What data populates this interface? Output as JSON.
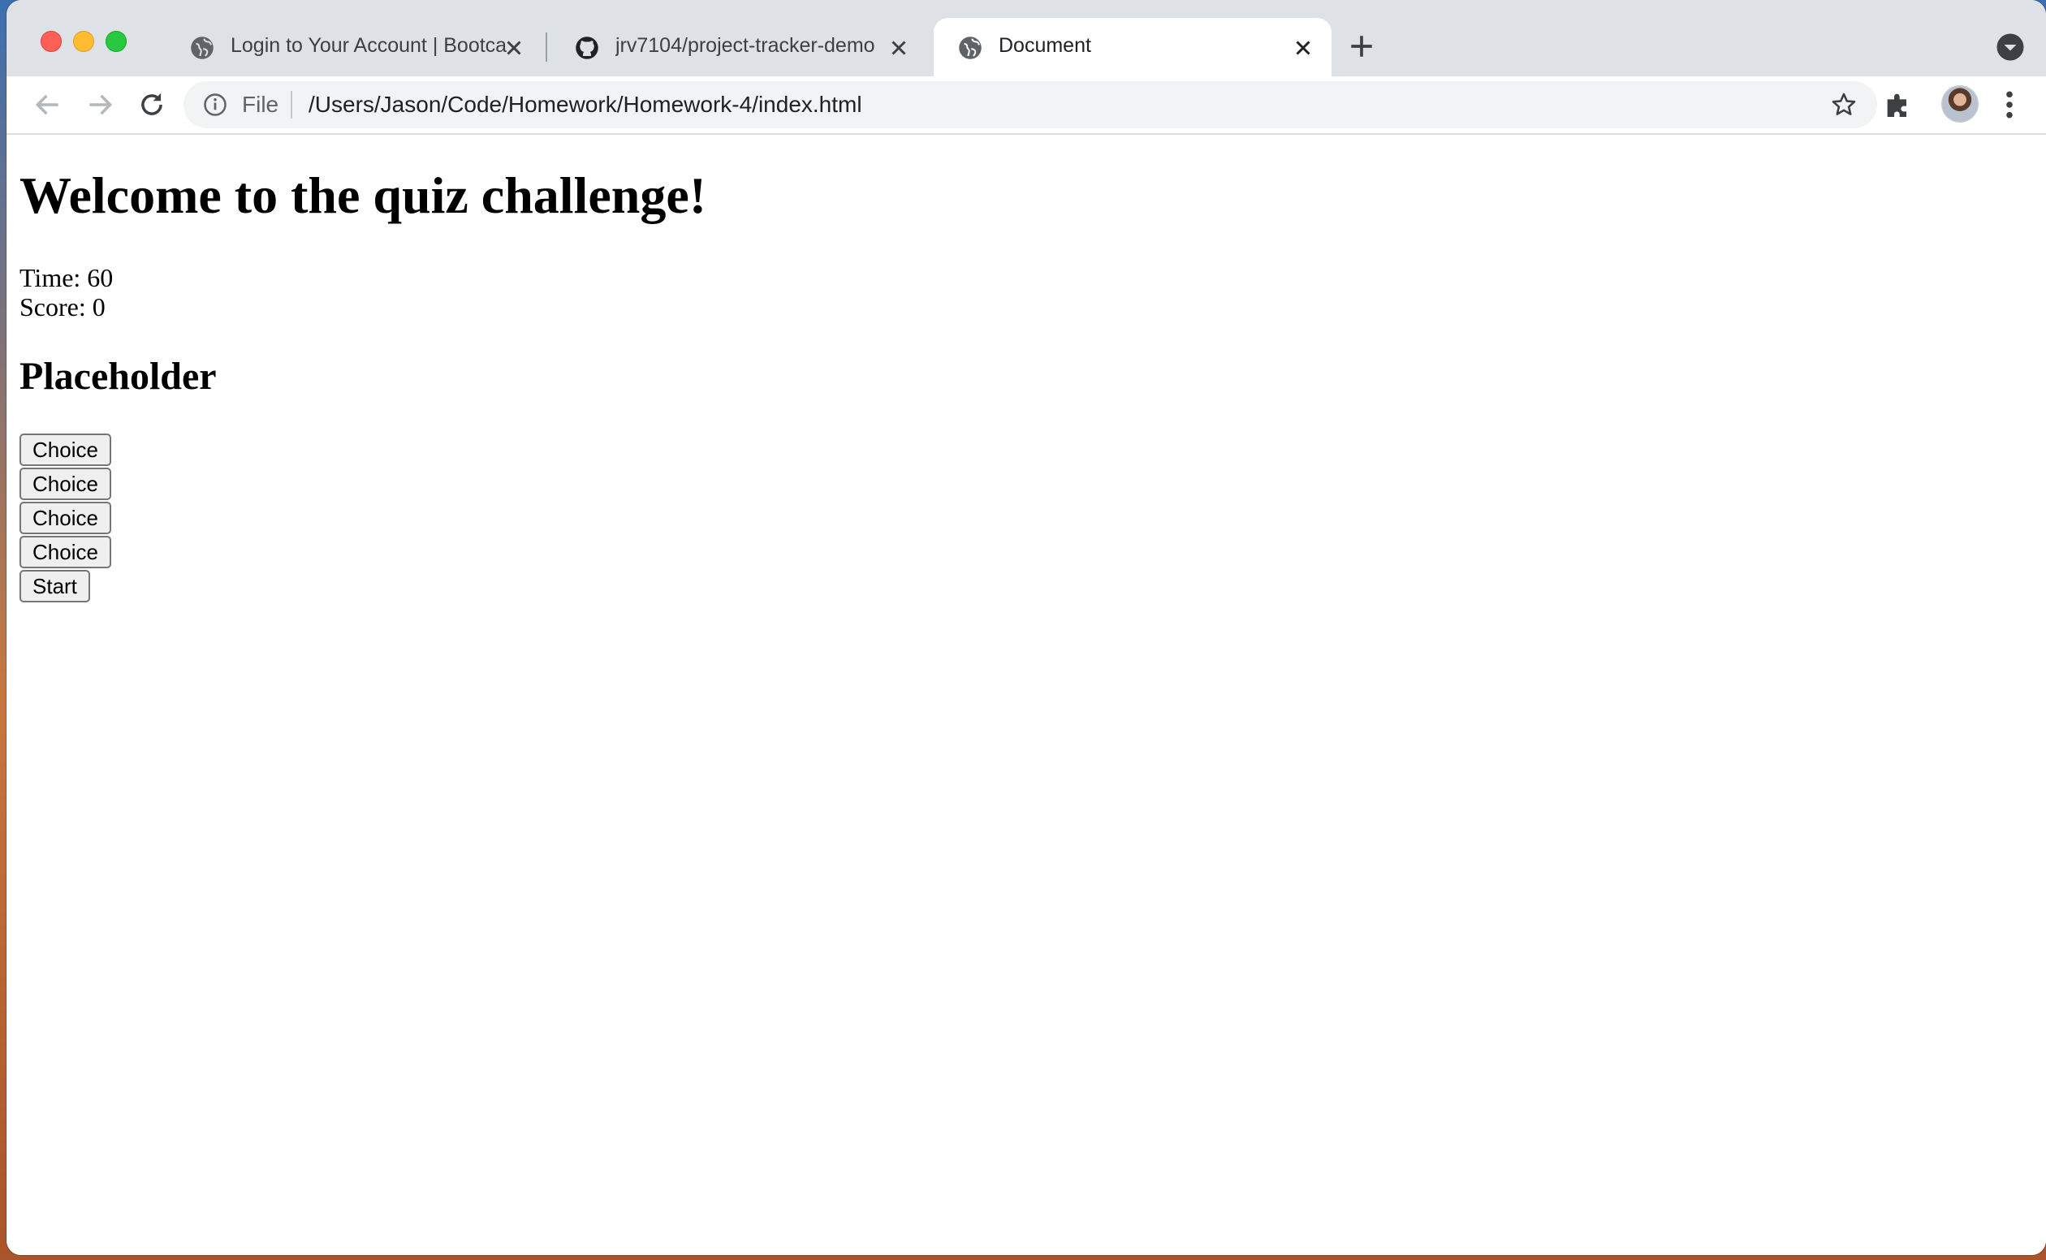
{
  "browser": {
    "tabs": [
      {
        "title": "Login to Your Account | Bootca",
        "active": false,
        "icon": "globe-icon"
      },
      {
        "title": "jrv7104/project-tracker-demo",
        "active": false,
        "icon": "github-icon"
      },
      {
        "title": "Document",
        "active": true,
        "icon": "globe-icon"
      }
    ],
    "omnibox": {
      "scheme_label": "File",
      "url": "/Users/Jason/Code/Homework/Homework-4/index.html"
    }
  },
  "page": {
    "heading": "Welcome to the quiz challenge!",
    "time_text": "Time: 60",
    "score_text": "Score: 0",
    "question": "Placeholder",
    "choices": [
      "Choice",
      "Choice",
      "Choice",
      "Choice"
    ],
    "start_label": "Start"
  },
  "colors": {
    "tabstrip": "#dee1e6",
    "omnibox": "#f1f3f4",
    "close": "#fe5f57",
    "minimize": "#febc2e",
    "maximize": "#28c840"
  }
}
